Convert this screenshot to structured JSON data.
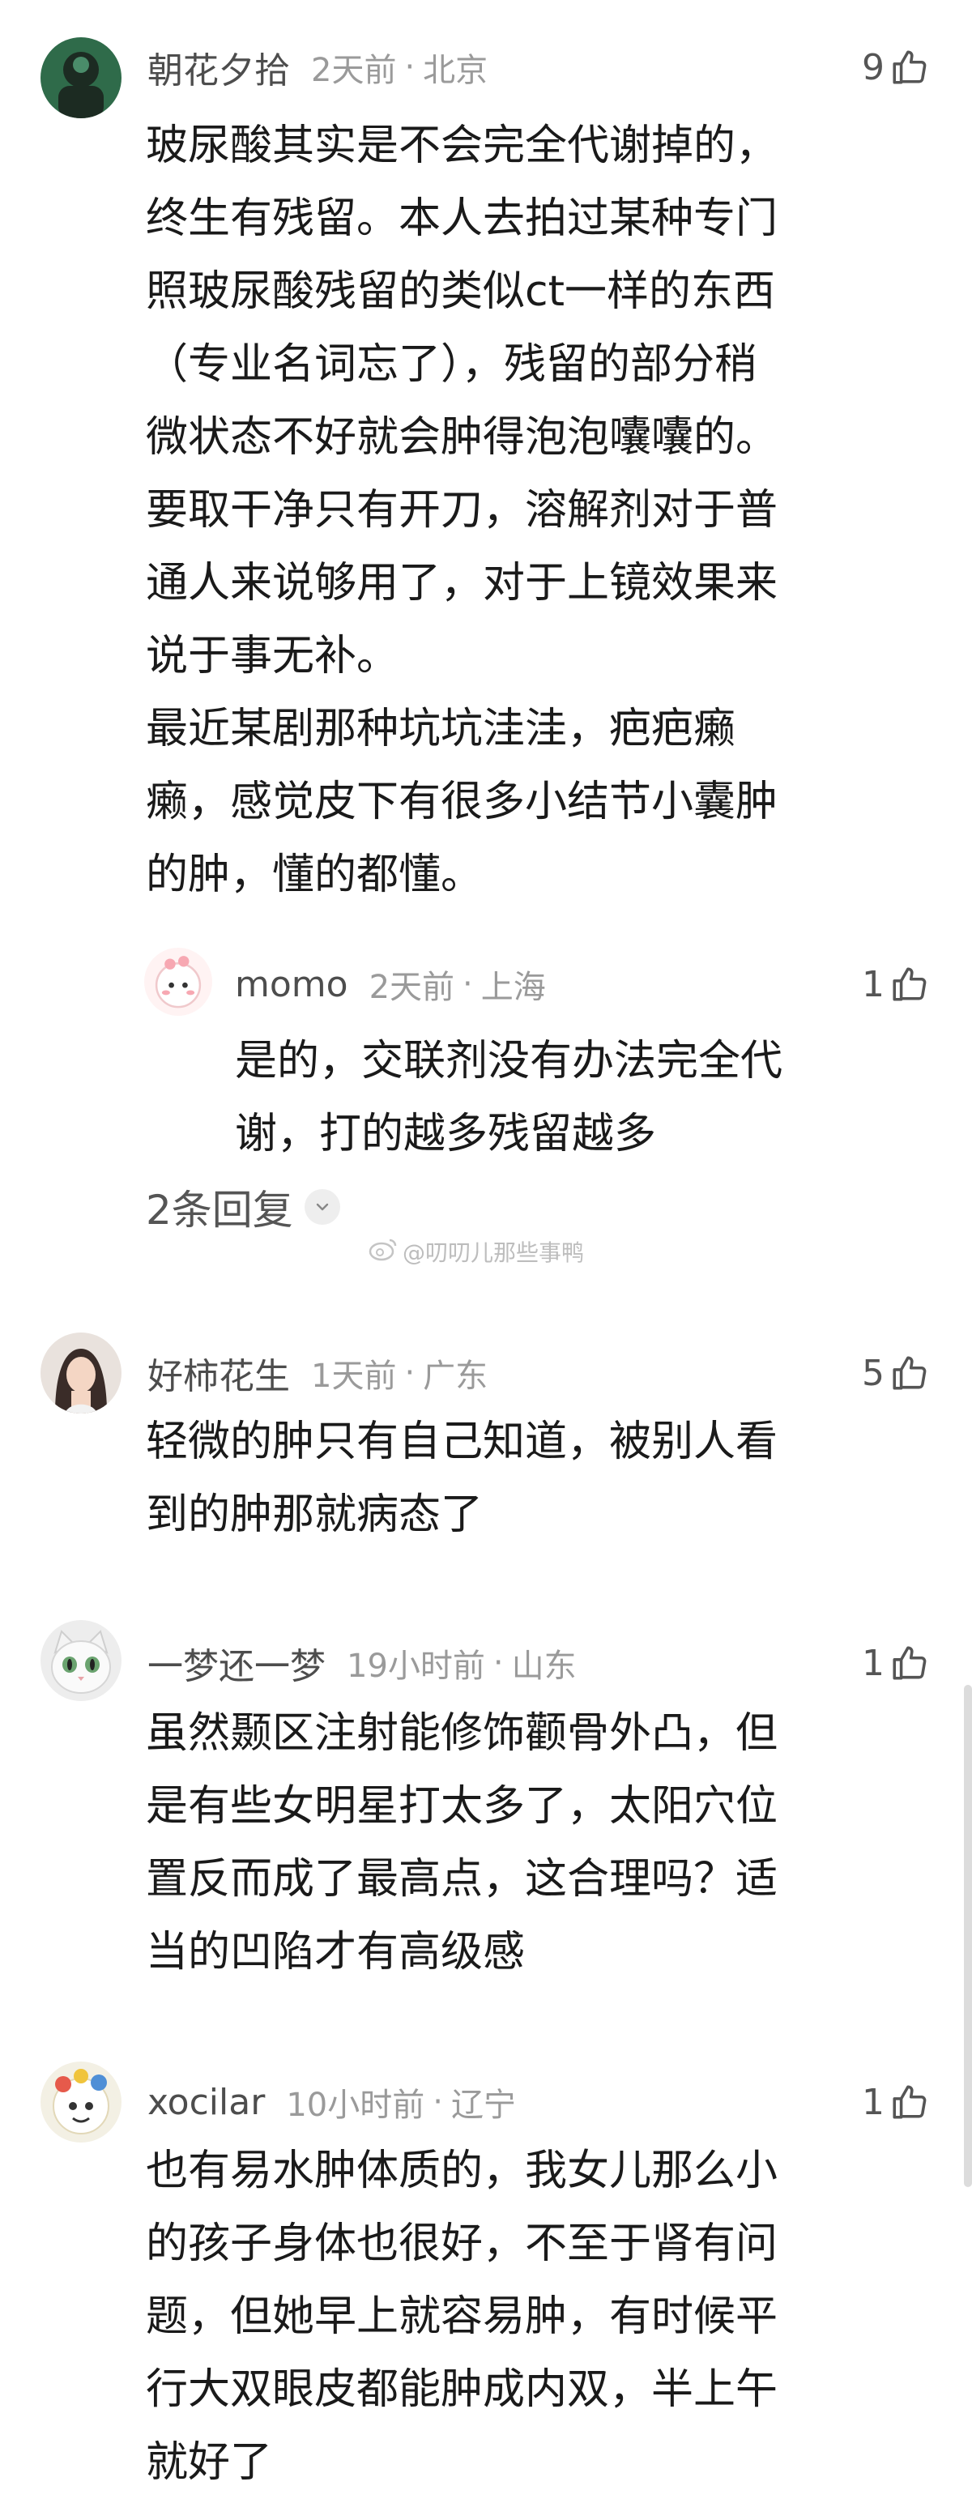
{
  "comments": [
    {
      "username": "朝花夕拾",
      "time": "2天前",
      "location": "北京",
      "likes": "9",
      "text": "玻尿酸其实是不会完全代谢掉的，\n终生有残留。本人去拍过某种专门\n照玻尿酸残留的类似ct一样的东西\n（专业名词忘了），残留的部分稍\n微状态不好就会肿得泡泡囔囔的。\n要取干净只有开刀，溶解剂对于普\n通人来说够用了，对于上镜效果来\n说于事无补。\n最近某剧那种坑坑洼洼，疤疤癞\n癞，感觉皮下有很多小结节小囊肿\n的肿，懂的都懂。",
      "reply": {
        "username": "momo",
        "time": "2天前",
        "location": "上海",
        "likes": "1",
        "text": "是的，交联剂没有办法完全代\n谢，打的越多残留越多"
      },
      "more_replies": "2条回复"
    },
    {
      "username": "好柿花生",
      "time": "1天前",
      "location": "广东",
      "likes": "5",
      "text": "轻微的肿只有自己知道，被别人看\n到的肿那就病态了"
    },
    {
      "username": "一梦还一梦",
      "time": "19小时前",
      "location": "山东",
      "likes": "1",
      "text": "虽然颞区注射能修饰颧骨外凸，但\n是有些女明星打太多了，太阳穴位\n置反而成了最高点，这合理吗？适\n当的凹陷才有高级感"
    },
    {
      "username": "xocilar",
      "time": "10小时前",
      "location": "辽宁",
      "likes": "1",
      "text": "也有易水肿体质的，我女儿那么小\n的孩子身体也很好，不至于肾有问\n题，但她早上就容易肿，有时候平\n行大双眼皮都能肿成内双，半上午\n就好了"
    }
  ],
  "watermark": "@叨叨儿那些事鸭",
  "icons": {
    "like": "thumbs-up-icon",
    "expand": "chevron-down-icon",
    "watermark": "weibo-icon"
  },
  "colors": {
    "username": "#4d4d4d",
    "meta": "#9a9a9a",
    "text": "#1a1a1a"
  }
}
